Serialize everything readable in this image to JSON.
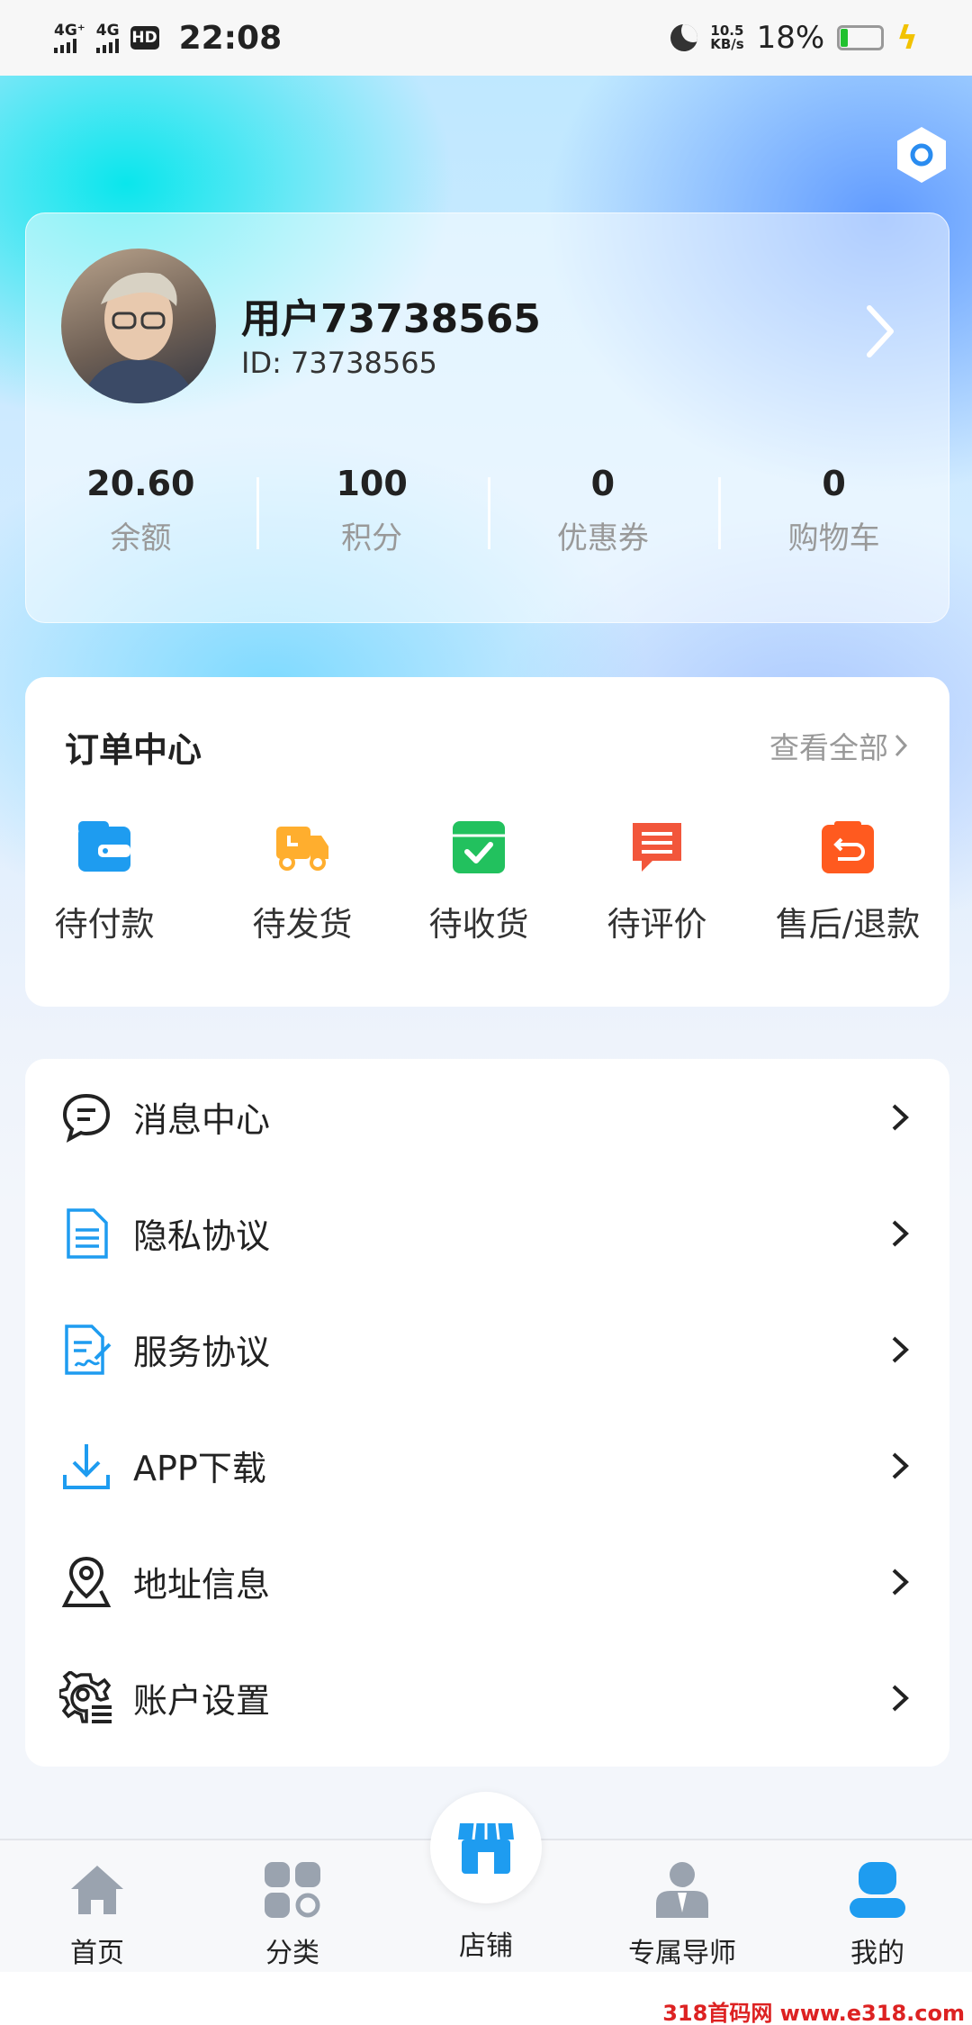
{
  "status_bar": {
    "net1": "4G⁺",
    "net2": "4G",
    "hd": "HD",
    "time": "22:08",
    "speed_value": "10.5",
    "speed_unit": "KB/s",
    "battery": "18%"
  },
  "profile": {
    "username": "用户73738565",
    "user_id": "ID: 73738565",
    "stats": [
      {
        "value": "20.60",
        "label": "余额"
      },
      {
        "value": "100",
        "label": "积分"
      },
      {
        "value": "0",
        "label": "优惠券"
      },
      {
        "value": "0",
        "label": "购物车"
      }
    ]
  },
  "order_center": {
    "title": "订单中心",
    "view_all": "查看全部",
    "items": [
      {
        "label": "待付款",
        "icon": "wallet-icon",
        "color": "#1e9cf0"
      },
      {
        "label": "待发货",
        "icon": "truck-icon",
        "color": "#ffae2e"
      },
      {
        "label": "待收货",
        "icon": "box-check-icon",
        "color": "#22c15e"
      },
      {
        "label": "待评价",
        "icon": "comment-icon",
        "color": "#f2563b"
      },
      {
        "label": "售后/退款",
        "icon": "return-icon",
        "color": "#ff5a1f"
      }
    ]
  },
  "menu": [
    {
      "label": "消息中心",
      "icon": "chat-bubble-icon"
    },
    {
      "label": "隐私协议",
      "icon": "document-icon"
    },
    {
      "label": "服务协议",
      "icon": "signed-document-icon"
    },
    {
      "label": "APP下载",
      "icon": "download-icon"
    },
    {
      "label": "地址信息",
      "icon": "location-pin-icon"
    },
    {
      "label": "账户设置",
      "icon": "gear-list-icon"
    }
  ],
  "tabbar": [
    {
      "label": "首页",
      "icon": "home-icon"
    },
    {
      "label": "分类",
      "icon": "category-icon"
    },
    {
      "label": "店铺",
      "icon": "store-icon"
    },
    {
      "label": "专属导师",
      "icon": "mentor-icon"
    },
    {
      "label": "我的",
      "icon": "user-icon"
    }
  ],
  "watermark": "318首码网 www.e318.com",
  "colors": {
    "accent": "#1e9cf0",
    "tab_inactive": "#9aa3af"
  }
}
